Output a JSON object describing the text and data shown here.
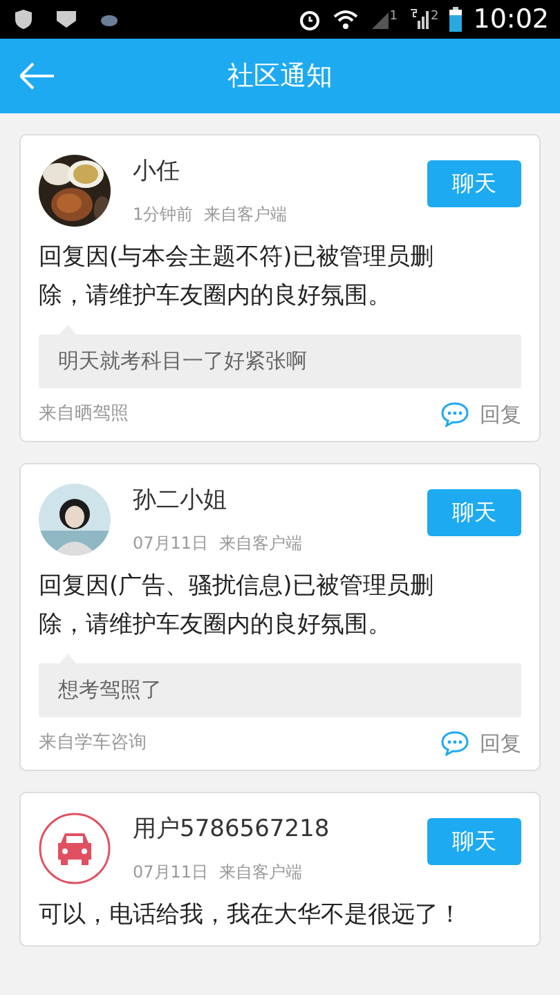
{
  "status_bar": {
    "time": "10:02",
    "sim_1": "1",
    "sim_2": "2"
  },
  "header": {
    "title": "社区通知"
  },
  "notifications": [
    {
      "name": "小任",
      "time": "1分钟前",
      "source": "来自客户端",
      "chat": "聊天",
      "message": "回复因(与本会主题不符)已被管理员删除，请维护车友圈内的良好氛围。",
      "quote": "明天就考科目一了好紧张啊",
      "origin": "来自晒驾照",
      "reply": "回复"
    },
    {
      "avatar": {
        "kind": "person"
      },
      "name": "孙二小姐",
      "time": "07月11日",
      "source": "来自客户端",
      "chat": "聊天",
      "message": "回复因(广告、骚扰信息)已被管理员删除，请维护车友圈内的良好氛围。",
      "quote": "想考驾照了",
      "origin": "来自学车咨询",
      "reply": "回复"
    },
    {
      "avatar": {
        "kind": "car"
      },
      "name": "用户5786567218",
      "time": "07月11日",
      "source": "来自客户端",
      "chat": "聊天",
      "message": "可以，电话给我，我在大华不是很远了！"
    }
  ]
}
